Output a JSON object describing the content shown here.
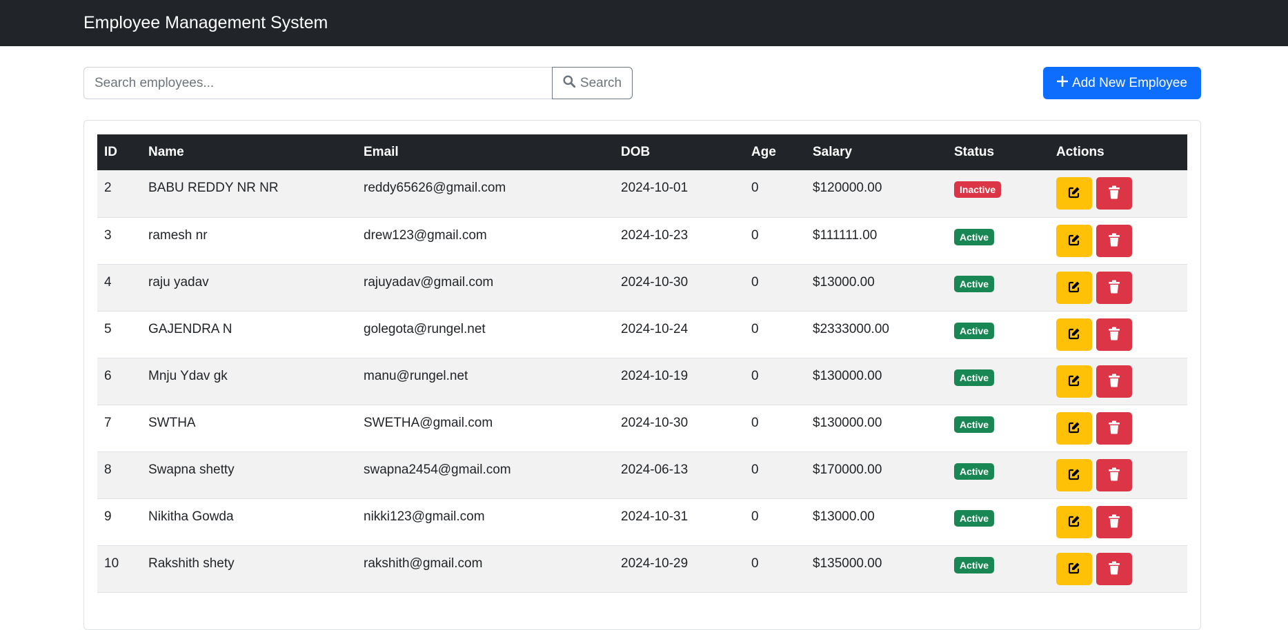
{
  "navbar": {
    "brand": "Employee Management System"
  },
  "search": {
    "placeholder": "Search employees...",
    "value": "",
    "button_label": "Search",
    "icon": "search-icon"
  },
  "add_button": {
    "label": "Add New Employee",
    "icon": "plus-icon"
  },
  "colors": {
    "navbar": "#212529",
    "primary": "#0d6efd",
    "warning": "#ffc107",
    "danger": "#dc3545",
    "success": "#198754",
    "secondary": "#6c757d"
  },
  "table": {
    "headers": [
      "ID",
      "Name",
      "Email",
      "DOB",
      "Age",
      "Salary",
      "Status",
      "Actions"
    ],
    "rows": [
      {
        "id": "2",
        "name": "BABU REDDY NR NR",
        "email": "reddy65626@gmail.com",
        "dob": "2024-10-01",
        "age": "0",
        "salary": "$120000.00",
        "status": "Inactive"
      },
      {
        "id": "3",
        "name": "ramesh nr",
        "email": "drew123@gmail.com",
        "dob": "2024-10-23",
        "age": "0",
        "salary": "$111111.00",
        "status": "Active"
      },
      {
        "id": "4",
        "name": "raju yadav",
        "email": "rajuyadav@gmail.com",
        "dob": "2024-10-30",
        "age": "0",
        "salary": "$13000.00",
        "status": "Active"
      },
      {
        "id": "5",
        "name": "GAJENDRA N",
        "email": "golegota@rungel.net",
        "dob": "2024-10-24",
        "age": "0",
        "salary": "$2333000.00",
        "status": "Active"
      },
      {
        "id": "6",
        "name": "Mnju Ydav gk",
        "email": "manu@rungel.net",
        "dob": "2024-10-19",
        "age": "0",
        "salary": "$130000.00",
        "status": "Active"
      },
      {
        "id": "7",
        "name": "SWTHA",
        "email": "SWETHA@gmail.com",
        "dob": "2024-10-30",
        "age": "0",
        "salary": "$130000.00",
        "status": "Active"
      },
      {
        "id": "8",
        "name": "Swapna shetty",
        "email": "swapna2454@gmail.com",
        "dob": "2024-06-13",
        "age": "0",
        "salary": "$170000.00",
        "status": "Active"
      },
      {
        "id": "9",
        "name": "Nikitha Gowda",
        "email": "nikki123@gmail.com",
        "dob": "2024-10-31",
        "age": "0",
        "salary": "$13000.00",
        "status": "Active"
      },
      {
        "id": "10",
        "name": "Rakshith shety",
        "email": "rakshith@gmail.com",
        "dob": "2024-10-29",
        "age": "0",
        "salary": "$135000.00",
        "status": "Active"
      }
    ],
    "row_actions": {
      "edit_icon": "edit-icon",
      "delete_icon": "trash-icon"
    }
  }
}
